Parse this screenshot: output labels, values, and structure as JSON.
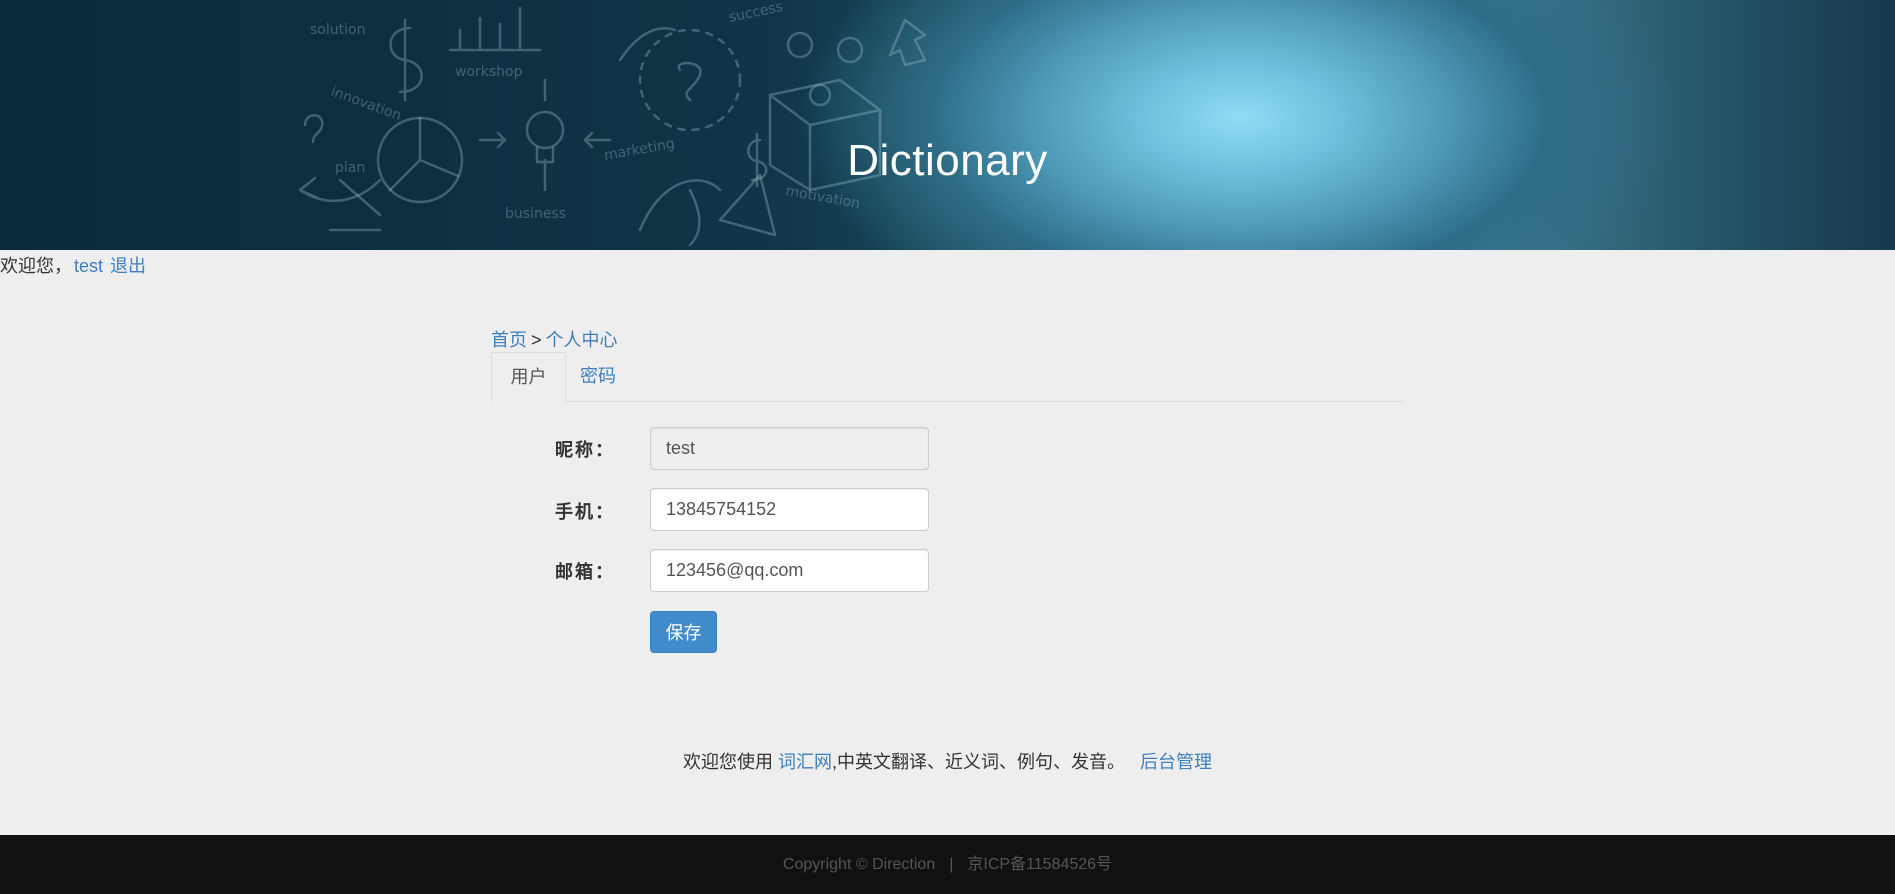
{
  "banner": {
    "title": "Dictionary"
  },
  "welcome": {
    "greeting": "欢迎您，",
    "username": "test",
    "logout": "退出"
  },
  "breadcrumb": {
    "home": "首页",
    "separator": ">",
    "current": "个人中心"
  },
  "tabs": [
    {
      "label": "用户",
      "active": true
    },
    {
      "label": "密码",
      "active": false
    }
  ],
  "form": {
    "nickname_label": "昵称：",
    "nickname_value": "test",
    "phone_label": "手机：",
    "phone_value": "13845754152",
    "email_label": "邮箱：",
    "email_value": "123456@qq.com",
    "save_label": "保存"
  },
  "promo": {
    "prefix": "欢迎您使用",
    "site_link": "词汇网",
    "suffix": ",中英文翻译、近义词、例句、发音。",
    "admin_link": "后台管理"
  },
  "footer": {
    "copyright": "Copyright © Direction",
    "divider": "|",
    "icp": "京ICP备11584526号"
  },
  "colors": {
    "link": "#3d7fc0",
    "primary_button": "#428bca",
    "page_background": "#eeeeee",
    "footer_background": "#111111"
  }
}
